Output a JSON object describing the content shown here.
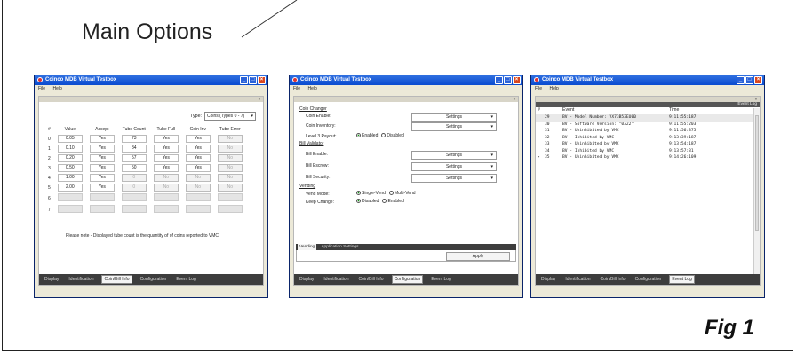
{
  "figure": {
    "heading": "Main Options",
    "caption": "Fig 1"
  },
  "windows": [
    {
      "title": "Coinco MDB Virtual Testbox",
      "menu": [
        "File",
        "Help"
      ],
      "type_label": "Type:",
      "type_value": "Coins (Types 0 - 7)",
      "columns": [
        "#",
        "Value",
        "Accept",
        "Tube Count",
        "Tube Full",
        "Coin Inv",
        "Tube Error"
      ],
      "rows": [
        [
          "0",
          "0.05",
          "Yes",
          "73",
          "Yes",
          "Yes",
          "No"
        ],
        [
          "1",
          "0.10",
          "Yes",
          "84",
          "Yes",
          "Yes",
          "No"
        ],
        [
          "2",
          "0.20",
          "Yes",
          "57",
          "Yes",
          "Yes",
          "No"
        ],
        [
          "3",
          "0.50",
          "Yes",
          "50",
          "Yes",
          "Yes",
          "No"
        ],
        [
          "4",
          "1.00",
          "Yes",
          "0",
          "No",
          "No",
          "No"
        ],
        [
          "5",
          "2.00",
          "Yes",
          "0",
          "No",
          "No",
          "No"
        ],
        [
          "6",
          "",
          "",
          "",
          "",
          "",
          ""
        ],
        [
          "7",
          "",
          "",
          "",
          "",
          "",
          ""
        ]
      ],
      "note": "Please note - Displayed tube count is the quantity of of coins reported to VMC",
      "tabs": [
        "Display",
        "Identification",
        "Coin/Bill Info",
        "Configuration",
        "Event Log"
      ],
      "active_tab": "Coin/Bill Info"
    },
    {
      "title": "Coinco MDB Virtual Testbox",
      "menu": [
        "File",
        "Help"
      ],
      "coin_changer": {
        "section": "Coin Changer",
        "coin_enable": "Coin Enable:",
        "coin_inventory": "Coin Inventory:",
        "level3": "Level 3 Payout:",
        "settings": "Settings",
        "enabled": "Enabled",
        "disabled": "Disabled"
      },
      "bill_validator": {
        "section": "Bill Validator",
        "bill_enable": "Bill Enable:",
        "bill_escrow": "Bill Escrow:",
        "bill_security": "Bill Security:",
        "settings": "Settings"
      },
      "vending": {
        "section": "Vending",
        "vend_mode": "Vend Mode:",
        "single": "Single-Vend",
        "multi": "Multi-Vend",
        "keep_change": "Keep Change:",
        "disabled": "Disabled",
        "enabled": "Enabled"
      },
      "subtabs": [
        "Vending",
        "Application Settings"
      ],
      "apply": "Apply",
      "tabs": [
        "Display",
        "Identification",
        "Coin/Bill Info",
        "Configuration",
        "Event Log"
      ],
      "active_tab": "Configuration"
    },
    {
      "title": "Coinco MDB Virtual Testbox",
      "menu": [
        "File",
        "Help"
      ],
      "log_title": "Event Log",
      "columns": [
        "#",
        "Event",
        "Time"
      ],
      "rows": [
        [
          "29",
          "BV - Model Number: VX73B53EU00",
          "9:11:55:187"
        ],
        [
          "30",
          "BV - Software Version: \"0322\"",
          "9:11:55:203"
        ],
        [
          "31",
          "BV - Uninhibited by VMC",
          "9:11:56:375"
        ],
        [
          "32",
          "BV - Inhibited by VMC",
          "9:13:39:187"
        ],
        [
          "33",
          "BV - Uninhibited by VMC",
          "9:13:54:187"
        ],
        [
          "34",
          "BV - Inhibited by VMC",
          "9:13:57:31"
        ],
        [
          "35",
          "BV - Uninhibited by VMC",
          "9:14:26:109"
        ]
      ],
      "tabs": [
        "Display",
        "Identification",
        "Coin/Bill Info",
        "Configuration",
        "Event Log"
      ],
      "active_tab": "Event Log"
    }
  ]
}
